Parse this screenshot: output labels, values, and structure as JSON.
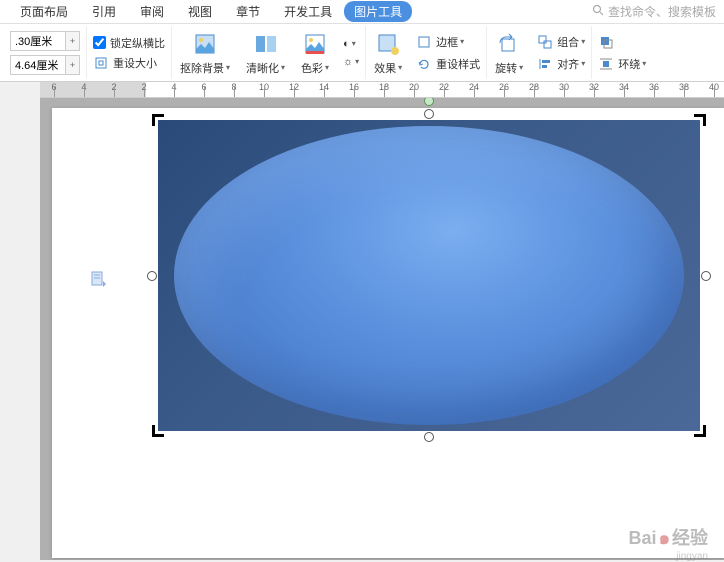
{
  "menu": {
    "items": [
      "页面布局",
      "引用",
      "审阅",
      "视图",
      "章节",
      "开发工具"
    ],
    "active_tab": "图片工具",
    "search_placeholder": "查找命令、搜索模板"
  },
  "toolbar": {
    "height_value": ".30厘米",
    "width_value": "4.64厘米",
    "lock_ratio": "锁定纵横比",
    "reset_size": "重设大小",
    "remove_bg": "抠除背景",
    "sharpen": "清晰化",
    "color": "色彩",
    "effects": "效果",
    "border": "边框",
    "reset_style": "重设样式",
    "rotate": "旋转",
    "group": "组合",
    "align": "对齐",
    "wrap": "环绕"
  },
  "ruler": {
    "numbers": [
      6,
      4,
      2,
      2,
      4,
      6,
      8,
      10,
      12,
      14,
      16,
      18,
      20,
      22,
      24,
      26,
      28,
      30,
      32,
      34,
      36,
      38,
      40
    ]
  },
  "watermark": {
    "brand": "Bai",
    "brand2": "经验",
    "sub": "jingyan"
  }
}
